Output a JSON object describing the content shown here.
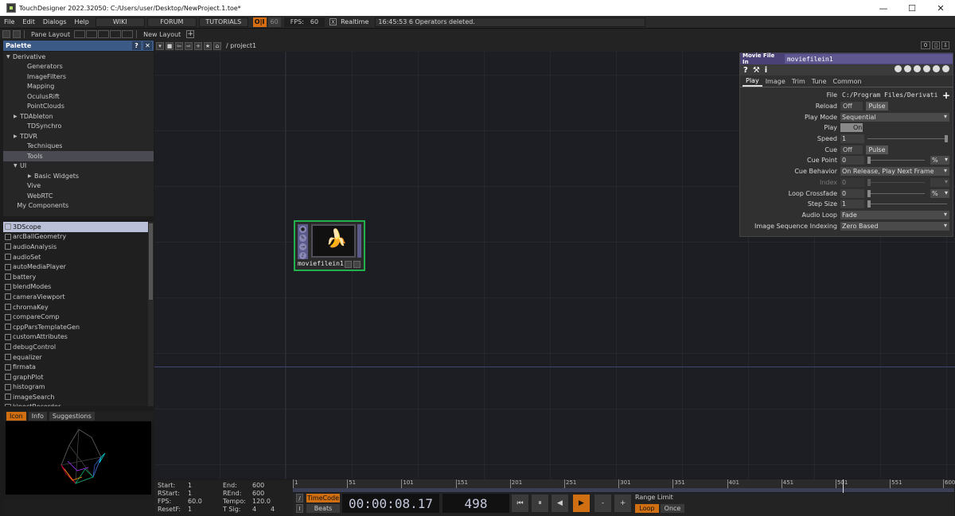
{
  "window": {
    "title": "TouchDesigner 2022.32050: C:/Users/user/Desktop/NewProject.1.toe*",
    "minimize": "—",
    "maximize": "☐",
    "close": "✕"
  },
  "menubar": {
    "items": [
      "File",
      "Edit",
      "Dialogs",
      "Help"
    ],
    "nav": [
      "WIKI",
      "FORUM",
      "TUTORIALS"
    ],
    "oi": "O|I",
    "fps_cap": "60",
    "fps_label": "FPS:",
    "fps_value": "60",
    "realtime_check": "X",
    "realtime_label": "Realtime",
    "status": "16:45:53 6 Operators deleted."
  },
  "layoutbar": {
    "pane_layout": "Pane Layout",
    "new_layout": "New Layout",
    "plus": "+"
  },
  "palette": {
    "title": "Palette",
    "help": "?",
    "close": "✕",
    "tree": [
      {
        "label": "Derivative",
        "depth": 0,
        "arrow": "▼"
      },
      {
        "label": "Generators",
        "depth": 2,
        "arrow": ""
      },
      {
        "label": "ImageFilters",
        "depth": 2,
        "arrow": ""
      },
      {
        "label": "Mapping",
        "depth": 2,
        "arrow": ""
      },
      {
        "label": "OculusRift",
        "depth": 2,
        "arrow": ""
      },
      {
        "label": "PointClouds",
        "depth": 2,
        "arrow": ""
      },
      {
        "label": "TDAbleton",
        "depth": 1,
        "arrow": "▶"
      },
      {
        "label": "TDSynchro",
        "depth": 2,
        "arrow": ""
      },
      {
        "label": "TDVR",
        "depth": 1,
        "arrow": "▶"
      },
      {
        "label": "Techniques",
        "depth": 2,
        "arrow": ""
      },
      {
        "label": "Tools",
        "depth": 2,
        "arrow": "",
        "selected": true
      },
      {
        "label": "UI",
        "depth": 1,
        "arrow": "▼"
      },
      {
        "label": "Basic Widgets",
        "depth": 3,
        "arrow": "▶"
      },
      {
        "label": "Vive",
        "depth": 2,
        "arrow": ""
      },
      {
        "label": "WebRTC",
        "depth": 2,
        "arrow": ""
      },
      {
        "label": "My Components",
        "depth": 0.6,
        "arrow": ""
      }
    ],
    "operators": [
      "3DScope",
      "arcBallGeometry",
      "audioAnalysis",
      "audioSet",
      "autoMediaPlayer",
      "battery",
      "blendModes",
      "cameraViewport",
      "chromaKey",
      "compareComp",
      "cppParsTemplateGen",
      "customAttributes",
      "debugControl",
      "equalizer",
      "firmata",
      "graphPlot",
      "histogram",
      "imageSearch",
      "kinectRecorder"
    ],
    "info_tabs": [
      "Icon",
      "Info",
      "Suggestions"
    ]
  },
  "network": {
    "path": "/ project1",
    "right_num": "0",
    "node": {
      "name": "moviefilein1",
      "glyph": "🍌"
    }
  },
  "params": {
    "type": "Movie File In",
    "op_name": "moviefilein1",
    "help": "?",
    "info": "i",
    "plus": "+",
    "tabs": [
      "Play",
      "Image",
      "Trim",
      "Tune",
      "Common"
    ],
    "rows": {
      "file": {
        "label": "File",
        "value": "C:/Program Files/Derivati"
      },
      "reload": {
        "label": "Reload",
        "toggle": "Off",
        "pulse": "Pulse"
      },
      "play_mode": {
        "label": "Play Mode",
        "value": "Sequential"
      },
      "play": {
        "label": "Play",
        "toggle": "On"
      },
      "speed": {
        "label": "Speed",
        "value": "1"
      },
      "cue": {
        "label": "Cue",
        "toggle": "Off",
        "pulse": "Pulse"
      },
      "cue_point": {
        "label": "Cue Point",
        "value": "0",
        "unit": "%"
      },
      "cue_behavior": {
        "label": "Cue Behavior",
        "value": "On Release, Play Next Frame"
      },
      "index": {
        "label": "Index",
        "value": "0"
      },
      "loop_crossfade": {
        "label": "Loop Crossfade",
        "value": "0",
        "unit": "%"
      },
      "step_size": {
        "label": "Step Size",
        "value": "1"
      },
      "audio_loop": {
        "label": "Audio Loop",
        "value": "Fade"
      },
      "image_seq": {
        "label": "Image Sequence Indexing",
        "value": "Zero Based"
      }
    }
  },
  "timeline": {
    "start_label": "Start:",
    "start": "1",
    "end_label": "End:",
    "end": "600",
    "rstart_label": "RStart:",
    "rstart": "1",
    "rend_label": "REnd:",
    "rend": "600",
    "fps_label": "FPS:",
    "fps": "60.0",
    "tempo_label": "Tempo:",
    "tempo": "120.0",
    "resetf_label": "ResetF:",
    "resetf": "1",
    "tsig_label": "T Sig:",
    "tsig_a": "4",
    "tsig_b": "4",
    "ticks": [
      "1",
      "51",
      "101",
      "151",
      "201",
      "251",
      "301",
      "351",
      "401",
      "451",
      "501",
      "551",
      "600"
    ],
    "timecode_btn": "TimeCode",
    "beats_btn": "Beats",
    "timecode": "00:00:08.17",
    "frame": "498",
    "btns": [
      "⏮",
      "⏸",
      "◀",
      "▶",
      "-",
      "+"
    ],
    "range_limit": "Range Limit",
    "loop": "Loop",
    "once": "Once",
    "slash": "/",
    "i": "I"
  }
}
